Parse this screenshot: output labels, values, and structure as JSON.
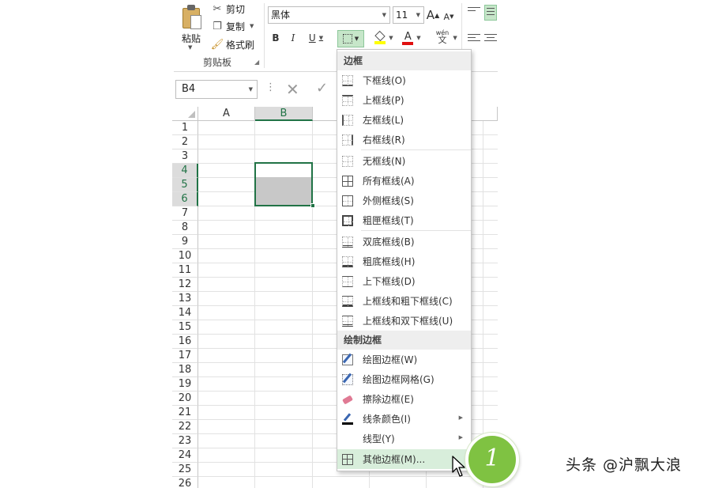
{
  "clipboard": {
    "paste_label": "粘贴",
    "cut_label": "剪切",
    "copy_label": "复制",
    "format_painter_label": "格式刷",
    "group_label": "剪贴板"
  },
  "font": {
    "name": "黑体",
    "size": "11",
    "grow_glyph": "A",
    "shrink_glyph": "A",
    "bold": "B",
    "italic": "I",
    "underline": "U",
    "phonetic_top": "wén",
    "phonetic_bottom": "文"
  },
  "formula_bar": {
    "name_box": "B4"
  },
  "sheet": {
    "columns": [
      "A",
      "B"
    ],
    "rows": [
      "1",
      "2",
      "3",
      "4",
      "5",
      "6",
      "7",
      "8",
      "9",
      "10",
      "11",
      "12",
      "13",
      "14",
      "15",
      "16",
      "17",
      "18",
      "19",
      "20",
      "21",
      "22",
      "23",
      "24",
      "25",
      "26"
    ],
    "selected_column": "B",
    "selected_rows": [
      "4",
      "5",
      "6"
    ]
  },
  "menu": {
    "header_borders": "边框",
    "items_group1": [
      {
        "label": "下框线(O)",
        "icon": "bottom-border-icon"
      },
      {
        "label": "上框线(P)",
        "icon": "top-border-icon"
      },
      {
        "label": "左框线(L)",
        "icon": "left-border-icon"
      },
      {
        "label": "右框线(R)",
        "icon": "right-border-icon"
      }
    ],
    "items_group2": [
      {
        "label": "无框线(N)",
        "icon": "no-border-icon"
      },
      {
        "label": "所有框线(A)",
        "icon": "all-borders-icon"
      },
      {
        "label": "外侧框线(S)",
        "icon": "outside-borders-icon"
      },
      {
        "label": "粗匣框线(T)",
        "icon": "thick-box-border-icon"
      }
    ],
    "items_group3": [
      {
        "label": "双底框线(B)",
        "icon": "bottom-double-border-icon"
      },
      {
        "label": "粗底框线(H)",
        "icon": "thick-bottom-border-icon"
      },
      {
        "label": "上下框线(D)",
        "icon": "top-bottom-border-icon"
      },
      {
        "label": "上框线和粗下框线(C)",
        "icon": "top-thick-bottom-border-icon"
      },
      {
        "label": "上框线和双下框线(U)",
        "icon": "top-double-bottom-border-icon"
      }
    ],
    "header_draw": "绘制边框",
    "draw_items": [
      {
        "label": "绘图边框(W)",
        "icon": "draw-border-icon"
      },
      {
        "label": "绘图边框网格(G)",
        "icon": "draw-border-grid-icon"
      },
      {
        "label": "擦除边框(E)",
        "icon": "erase-border-icon"
      },
      {
        "label": "线条颜色(I)",
        "icon": "line-color-icon"
      },
      {
        "label": "线型(Y)",
        "icon": "line-style-icon"
      },
      {
        "label": "其他边框(M)...",
        "icon": "more-borders-icon"
      }
    ]
  },
  "annotation": {
    "step_number": "1",
    "badge_color": "#7fc242"
  },
  "watermark": "头条 @沪飘大浪",
  "colors": {
    "excel_green": "#217346",
    "hover_green": "#d8eedb"
  }
}
